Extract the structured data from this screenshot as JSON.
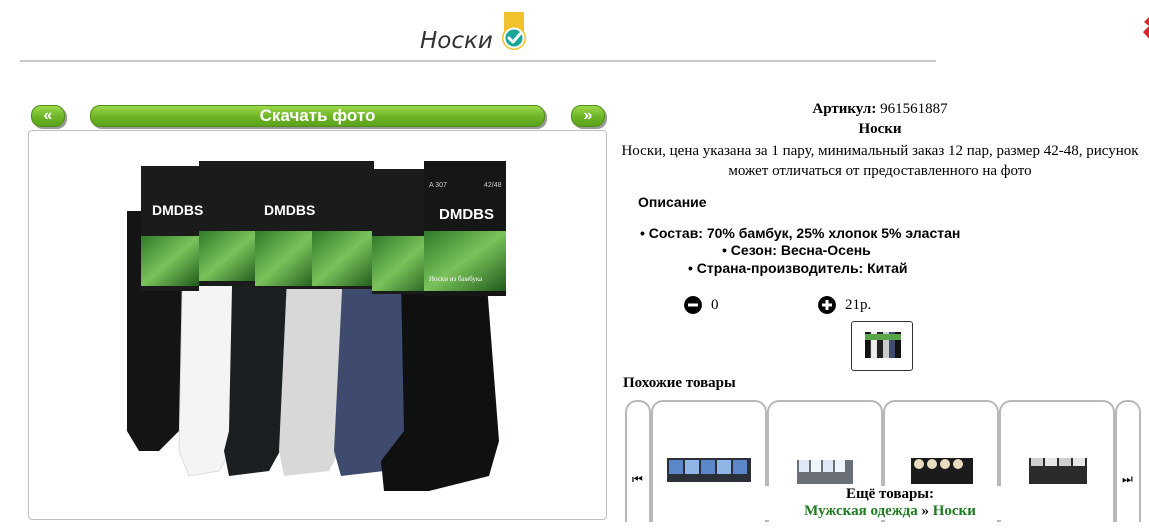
{
  "header": {
    "title": "Носки",
    "verified_icon": "verified-badge-icon"
  },
  "gallery": {
    "prev_label": "«",
    "download_label": "Скачать фото",
    "next_label": "»",
    "brand_text": "DMDBS",
    "model_text": "A 307",
    "size_text": "42/48",
    "pack_text": "Носки из бамбука"
  },
  "product": {
    "sku_label": "Артикул:",
    "sku_value": "961561887",
    "name": "Носки",
    "short_description": "Носки, цена указана за 1 пару, минимальный заказ 12 пар, размер 42-48, рисунок может отличаться от предоставленного на фото",
    "description_heading": "Описание",
    "features": [
      "Состав: 70% бамбук, 25% хлопок 5% эластан",
      "Сезон: Весна-Осень",
      "Страна-производитель: Китай"
    ],
    "quantity": "0",
    "price": "21р."
  },
  "similar": {
    "heading": "Похожие товары",
    "prev_icon": "skip-back-icon",
    "next_icon": "skip-forward-icon"
  },
  "more": {
    "heading": "Ещё товары:",
    "crumb_1": "Мужская одежда",
    "separator": "»",
    "crumb_2": "Носки"
  },
  "colors": {
    "accent_green": "#6db326",
    "link_green": "#1f7a1f",
    "check_teal": "#1aa79a",
    "badge_yellow": "#f2c12e"
  }
}
